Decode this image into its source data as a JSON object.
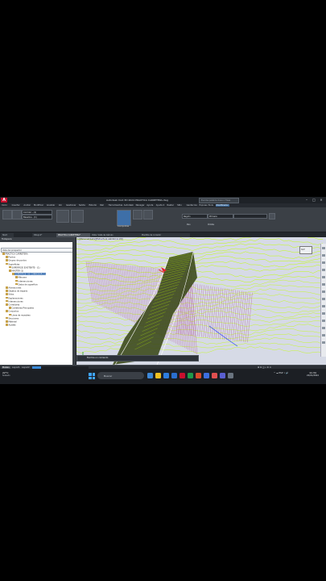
{
  "window": {
    "app_title": "Autodesk Civil 3D 2024  PRACTICA CARRETERA.dwg",
    "search_placeholder": "Escriba palabra clave o frase",
    "logo_letter": "A"
  },
  "menubar": [
    "Inicio",
    "Insertar",
    "Anotar",
    "Modificar",
    "Analizar",
    "Ver",
    "Gestionar",
    "Salida",
    "Estudio",
    "Rail",
    "Herramientas",
    "Autodesk",
    "Navegar",
    "Ayuda",
    "Ayuda 2",
    "Raster",
    "Sitio",
    "Geotecnia",
    "Express Tools",
    "Modificador"
  ],
  "ribbon": {
    "panels": [
      "Datos",
      "General",
      "Capas",
      "Modificar",
      "Navegar",
      "Cerrar"
    ],
    "corridor_field": "Corridor - (1)",
    "baseline_field": "Baseline - (1)",
    "region_field": "Región",
    "first_field": "Primera",
    "pan_label": "Pan",
    "orbit_label": "Órbita",
    "check_label": "Comprobar"
  },
  "doc_tabs": [
    "Start",
    "Dibujo1*",
    "PRACTICA CARRETERA*",
    "Vista: Vista de Cálculo",
    "Plantilla de corredor"
  ],
  "toolspace": {
    "title": "Toolspace",
    "view": "Vista del prospector",
    "tree": [
      {
        "label": "PRACTICA CARRETERA",
        "indent": 0
      },
      {
        "label": "Puntos",
        "indent": 1
      },
      {
        "label": "Grupos de puntos",
        "indent": 1
      },
      {
        "label": "Superficies",
        "indent": 1
      },
      {
        "label": "SUPERFICIE EXISTENTE - (1)",
        "indent": 2
      },
      {
        "label": "MASTER (1)",
        "indent": 2
      },
      {
        "label": "SUPERFICIE DE CORREDOR (1)",
        "indent": 3,
        "selected": true
      },
      {
        "label": "Máscara",
        "indent": 4
      },
      {
        "label": "Intersecciones",
        "indent": 4
      },
      {
        "label": "Datos de superficie",
        "indent": 4
      },
      {
        "label": "Alineaciones",
        "indent": 1
      },
      {
        "label": "Objetos de trazado",
        "indent": 1
      },
      {
        "label": "Sitios",
        "indent": 1
      },
      {
        "label": "Explanaciones",
        "indent": 1
      },
      {
        "label": "Intersecciones",
        "indent": 1
      },
      {
        "label": "Corredores",
        "indent": 1
      },
      {
        "label": "Carreteras Principales",
        "indent": 2
      },
      {
        "label": "Conjuntos",
        "indent": 1
      },
      {
        "label": "Línea de muestreo",
        "indent": 2
      },
      {
        "label": "Secciones",
        "indent": 1
      },
      {
        "label": "Material",
        "indent": 1
      },
      {
        "label": "Ajustes",
        "indent": 1
      }
    ]
  },
  "viewport": {
    "label": "[-][Personalizada][Estructura alámbrica 2D]",
    "viewcube": "SUP",
    "wire_color": "#c2ff00",
    "corridor_color": "#3d4a1c",
    "fill_color": "#a82c86",
    "arrow_color": "#e8202c"
  },
  "command_line": "Escriba un comando",
  "status": {
    "model_tab": "Modelo",
    "layout_tabs": [
      "Layout1",
      "Layout2"
    ],
    "progress_label": "Construyendo...",
    "progress_fraction": 0.15
  },
  "taskbar": {
    "weather_temp": "22°C",
    "weather_desc": "Soleado",
    "search_text": "Buscar",
    "tray_lang": "ESP",
    "time": "11:34",
    "date": "22/01/2024"
  }
}
